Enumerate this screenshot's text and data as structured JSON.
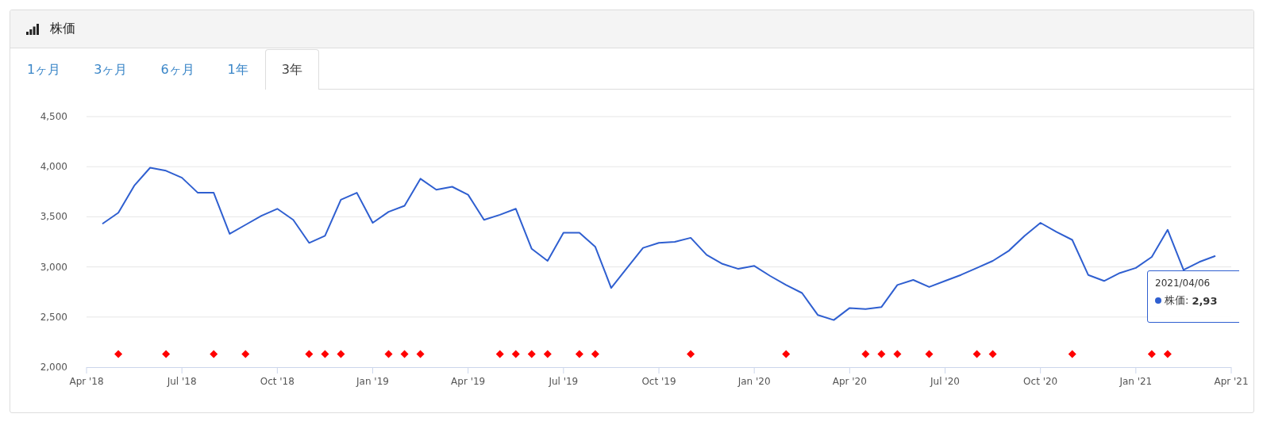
{
  "panel": {
    "title": "株価"
  },
  "tabs": [
    {
      "label": "1ヶ月",
      "selected": false
    },
    {
      "label": "3ヶ月",
      "selected": false
    },
    {
      "label": "6ヶ月",
      "selected": false
    },
    {
      "label": "1年",
      "selected": false
    },
    {
      "label": "3年",
      "selected": true
    }
  ],
  "chart_data": {
    "type": "line",
    "ylim": [
      2000,
      4500
    ],
    "yticks": [
      {
        "value": 2000,
        "label": "2,000"
      },
      {
        "value": 2500,
        "label": "2,500"
      },
      {
        "value": 3000,
        "label": "3,000"
      },
      {
        "value": 3500,
        "label": "3,500"
      },
      {
        "value": 4000,
        "label": "4,000"
      },
      {
        "value": 4500,
        "label": "4,500"
      }
    ],
    "categories": [
      "Apr '18",
      null,
      null,
      null,
      null,
      null,
      "Jul '18",
      null,
      null,
      null,
      null,
      null,
      "Oct '18",
      null,
      null,
      null,
      null,
      null,
      "Jan '19",
      null,
      null,
      null,
      null,
      null,
      "Apr '19",
      null,
      null,
      null,
      null,
      null,
      "Jul '19",
      null,
      null,
      null,
      null,
      null,
      "Oct '19",
      null,
      null,
      null,
      null,
      null,
      "Jan '20",
      null,
      null,
      null,
      null,
      null,
      "Apr '20",
      null,
      null,
      null,
      null,
      null,
      "Jul '20",
      null,
      null,
      null,
      null,
      null,
      "Oct '20",
      null,
      null,
      null,
      null,
      null,
      "Jan '21",
      null,
      null,
      null,
      null,
      null,
      "Apr '21"
    ],
    "series": [
      {
        "name": "株価",
        "color": "#2f5fd0",
        "values": [
          null,
          3430,
          3540,
          3810,
          3990,
          3960,
          3890,
          3740,
          3740,
          3330,
          3420,
          3510,
          3580,
          3470,
          3240,
          3310,
          3670,
          3740,
          3440,
          3550,
          3610,
          3880,
          3770,
          3800,
          3720,
          3470,
          3520,
          3580,
          3180,
          3060,
          3340,
          3340,
          3200,
          2790,
          2990,
          3190,
          3240,
          3250,
          3290,
          3120,
          3030,
          2980,
          3010,
          2910,
          2820,
          2740,
          2520,
          2470,
          2590,
          2580,
          2600,
          2820,
          2870,
          2800,
          2860,
          2920,
          2990,
          3060,
          3160,
          3310,
          3440,
          3350,
          3270,
          2920,
          2860,
          2940,
          2990,
          3100,
          3370,
          2970,
          3050,
          3110,
          null
        ]
      },
      {
        "type": "scatter",
        "color": "#ff0000",
        "values": [
          null,
          null,
          2130,
          null,
          null,
          2130,
          null,
          null,
          2130,
          null,
          2130,
          null,
          null,
          null,
          2130,
          2130,
          2130,
          null,
          null,
          2130,
          2130,
          2130,
          null,
          null,
          null,
          null,
          2130,
          2130,
          2130,
          2130,
          null,
          2130,
          2130,
          null,
          null,
          null,
          null,
          null,
          2130,
          null,
          null,
          null,
          null,
          null,
          2130,
          null,
          null,
          null,
          null,
          2130,
          2130,
          2130,
          null,
          2130,
          null,
          null,
          2130,
          2130,
          null,
          null,
          null,
          null,
          2130,
          null,
          null,
          null,
          null,
          2130,
          2130,
          null,
          null,
          null,
          null
        ]
      }
    ],
    "grid": true
  },
  "tooltip": {
    "date": "2021/04/06",
    "separator": ":",
    "value": "2,93"
  }
}
